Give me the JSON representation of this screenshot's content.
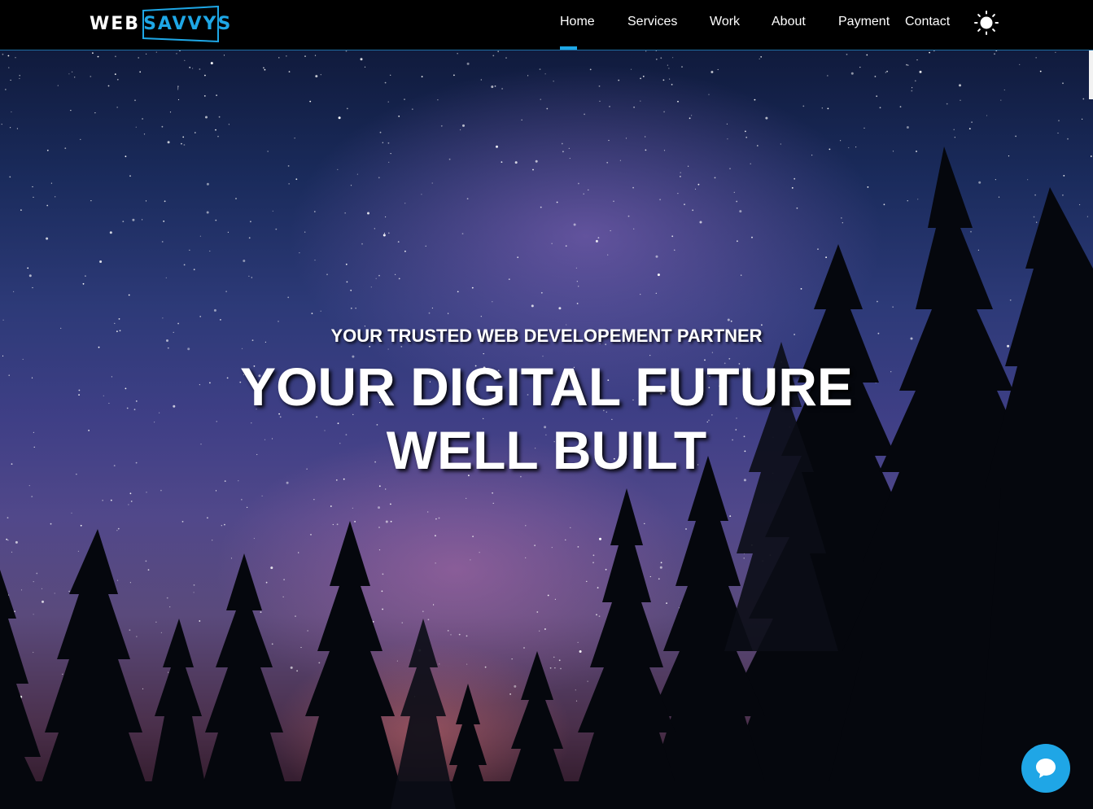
{
  "brand": {
    "logo_part1": "WEB",
    "logo_part2": "SAVVYS",
    "accent": "#1ea7e6"
  },
  "nav": {
    "items": [
      {
        "label": "Home",
        "active": true
      },
      {
        "label": "Services"
      },
      {
        "label": "Work"
      },
      {
        "label": "About"
      },
      {
        "label": "Payment"
      },
      {
        "label": "Contact"
      }
    ],
    "theme_toggle_icon": "sun-icon"
  },
  "hero": {
    "subtitle": "YOUR TRUSTED WEB DEVELOPEMENT PARTNER",
    "title_line1": "YOUR DIGITAL FUTURE",
    "title_line2": "WELL BUILT"
  },
  "chat": {
    "icon": "chat-bubble-icon",
    "color": "#1fa6e6"
  }
}
